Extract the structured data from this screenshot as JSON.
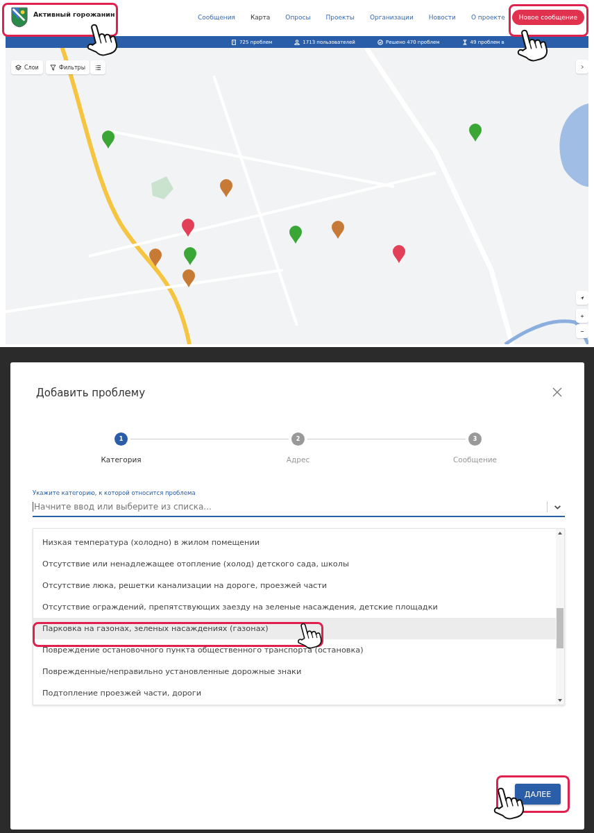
{
  "header": {
    "logo_title": "Активный горожанин",
    "nav": [
      {
        "label": "Сообщения",
        "selected": false
      },
      {
        "label": "Карта",
        "selected": true
      },
      {
        "label": "Опросы",
        "selected": false
      },
      {
        "label": "Проекты",
        "selected": false
      },
      {
        "label": "Организации",
        "selected": false
      },
      {
        "label": "Новости",
        "selected": false
      },
      {
        "label": "О проекте",
        "selected": false
      }
    ],
    "new_message_button": "Новое сообщение"
  },
  "stats": [
    {
      "kind": "problems",
      "text": "725 проблем"
    },
    {
      "kind": "users",
      "text": "1713 пользователей"
    },
    {
      "kind": "solved",
      "text": "Решено 470 проблем"
    },
    {
      "kind": "pending",
      "text": "49 проблем в"
    }
  ],
  "map": {
    "kind": "picture",
    "layers_button": "Слои",
    "filters_button": "Фильтры"
  },
  "dialog": {
    "title": "Добавить проблему",
    "steps": [
      {
        "number": "1",
        "label": "Категория",
        "selected": true
      },
      {
        "number": "2",
        "label": "Адрес",
        "selected": false
      },
      {
        "number": "3",
        "label": "Сообщение",
        "selected": false
      }
    ],
    "field_label": "Укажите категорию, к которой относится проблема",
    "placeholder": "Начните ввод или выберите из списка...",
    "options": [
      {
        "label": "Низкая температура (холодно) в жилом помещении",
        "selected": false
      },
      {
        "label": "Отсутствие или ненадлежащее отопление (холод) детского сада, школы",
        "selected": false
      },
      {
        "label": "Отсутствие люка, решетки канализации на дороге, проезжей части",
        "selected": false
      },
      {
        "label": "Отсутствие ограждений, препятствующих заезду на зеленые насаждения, детские площадки",
        "selected": false
      },
      {
        "label": "Парковка на газонах, зеленых насаждениях (газонах)",
        "selected": true
      },
      {
        "label": "Повреждение остановочного пункта общественного транспорта (остановка)",
        "selected": false
      },
      {
        "label": "Поврежденные/неправильно установленные дорожные знаки",
        "selected": false
      },
      {
        "label": "Подтопление проезжей части, дороги",
        "selected": false
      }
    ],
    "next_button": "ДАЛЕЕ"
  }
}
